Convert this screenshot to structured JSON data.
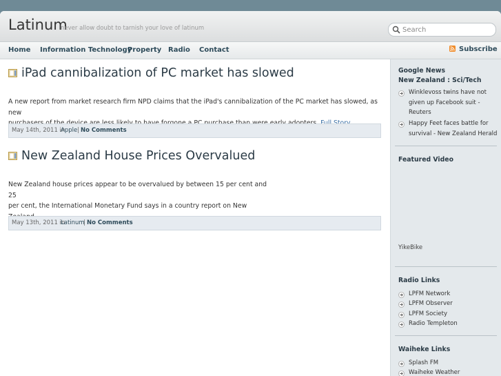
{
  "site": {
    "title": "Latinum",
    "tagline": "never allow doubt to tarnish your love of latinum"
  },
  "search": {
    "placeholder": "Search",
    "icon": "search-icon"
  },
  "nav": {
    "items": [
      "Home",
      "Information Technology",
      "Property",
      "Radio",
      "Contact"
    ],
    "subscribe_label": "Subscribe",
    "subscribe_icon": "rss-icon"
  },
  "posts": [
    {
      "title": "iPad cannibalization of PC market has slowed",
      "body_lines": [
        "A new report from market research firm NPD claims that the iPad's cannibalization of the PC market has slowed, as new",
        "purchasers of the device are less likely to have forgone a PC purchase than were early adopters."
      ],
      "link": "Full Story",
      "date": "May 14th, 2011 in",
      "category": "Apple",
      "separator": "|",
      "comments": "No Comments"
    },
    {
      "title": "New Zealand House Prices Overvalued",
      "body_lines": [
        "New Zealand house prices appear to be overvalued by between 15 per cent and 25",
        "per cent, the International Monetary Fund says in a country report on New",
        "Zealand."
      ],
      "date": "May 13th, 2011 in",
      "category": "Latinum",
      "separator": "|",
      "comments": "No Comments"
    }
  ],
  "sidebar": {
    "google_news": {
      "heading_line1": "Google News",
      "heading_line2": "New Zealand : Sci/Tech",
      "items": [
        [
          "Winklevoss twins have not",
          "given up Facebook suit -",
          "Reuters"
        ],
        [
          "Happy Feet faces battle for",
          "survival - New Zealand Herald"
        ]
      ]
    },
    "featured_video": {
      "heading": "Featured Video",
      "caption": "YikeBike"
    },
    "radio_links": {
      "heading": "Radio Links",
      "items": [
        "LPFM Network",
        "LPFM Observer",
        "LPFM Society",
        "Radio Templeton"
      ]
    },
    "waiheke_links": {
      "heading": "Waiheke Links",
      "items": [
        "Splash FM",
        "Waiheke Weather"
      ]
    }
  }
}
